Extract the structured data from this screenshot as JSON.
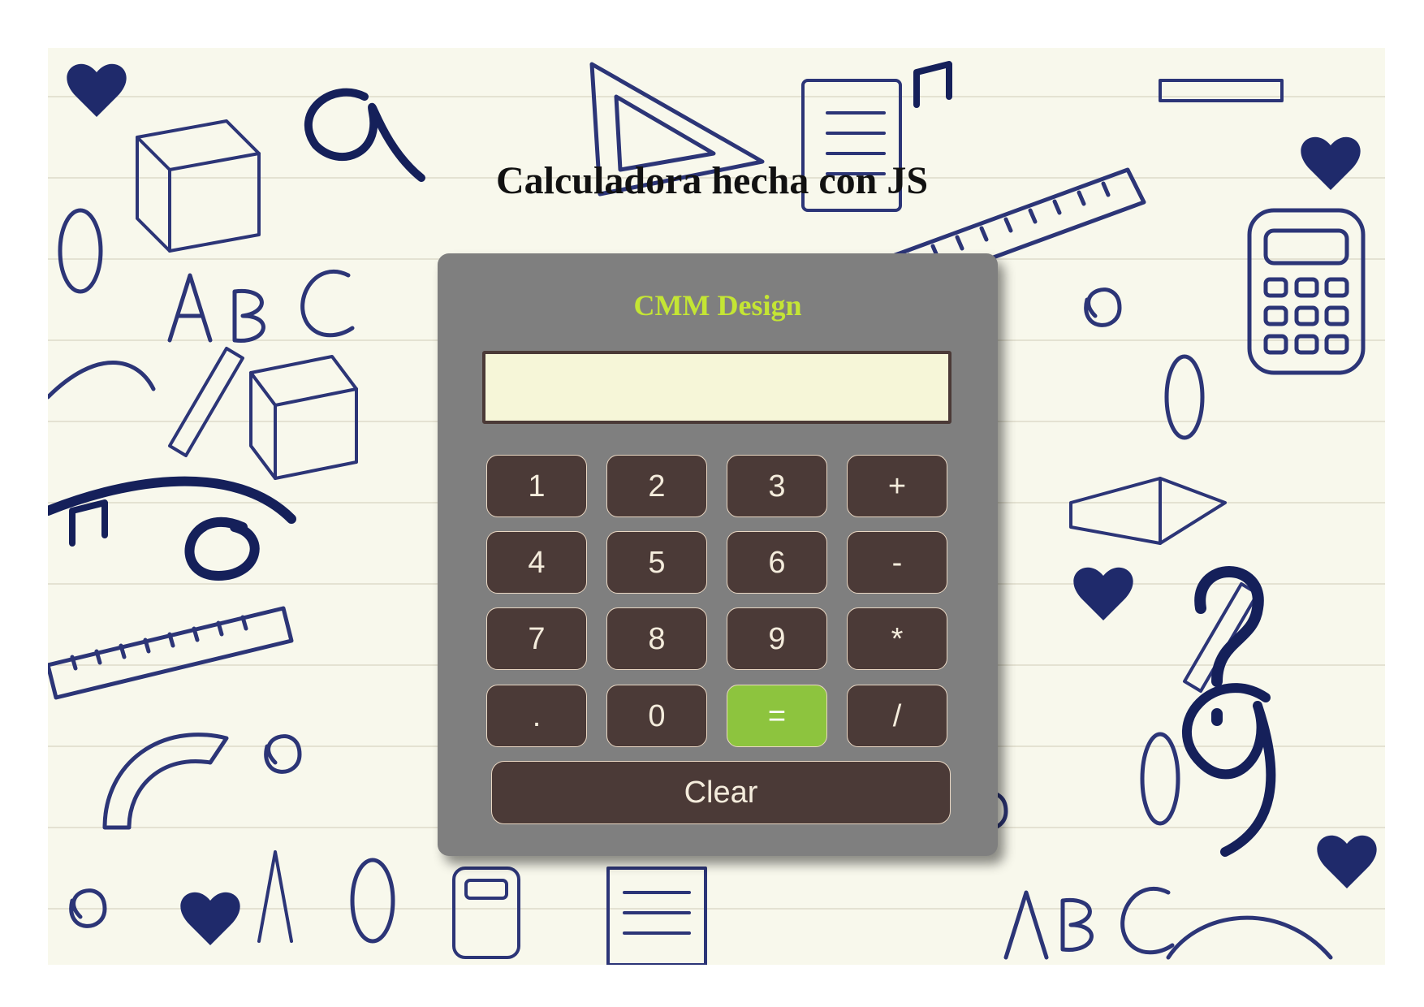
{
  "page": {
    "title": "Calculadora hecha con JS",
    "background": "school-doodles-pattern"
  },
  "calculator": {
    "brand": "CMM Design",
    "display": {
      "value": "",
      "placeholder": ""
    },
    "keys": {
      "one": "1",
      "two": "2",
      "three": "3",
      "plus": "+",
      "four": "4",
      "five": "5",
      "six": "6",
      "minus": "-",
      "seven": "7",
      "eight": "8",
      "nine": "9",
      "multiply": "*",
      "decimal": ".",
      "zero": "0",
      "equals": "=",
      "divide": "/"
    },
    "clear_label": "Clear"
  },
  "colors": {
    "calculator_body": "#7f7f7f",
    "brand_text": "#c4e534",
    "display_bg": "#f6f6d8",
    "key_bg": "#4b3a37",
    "key_text": "#f4ecdc",
    "equals_bg": "#8dc43e",
    "doodle_ink": "#1f2a6b"
  }
}
